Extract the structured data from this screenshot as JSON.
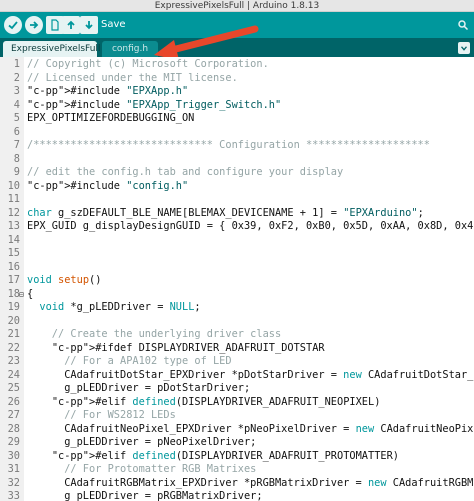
{
  "window": {
    "title": "ExpressivePixelsFull | Arduino 1.8.13"
  },
  "toolbar": {
    "verify_icon": "checkmark-icon",
    "upload_icon": "right-arrow-icon",
    "new_icon": "document-icon",
    "open_icon": "up-arrow-icon",
    "save_icon": "down-arrow-icon",
    "save_label": "Save",
    "serial_icon": "magnifier-icon"
  },
  "tabs": [
    {
      "label": "ExpressivePixelsFull",
      "active": true
    },
    {
      "label": "config.h",
      "active": false
    }
  ],
  "tab_menu_icon": "chevron-down-icon",
  "annotation": {
    "type": "red-arrow",
    "color": "#e8472b"
  },
  "colors": {
    "toolbar": "#00979c",
    "tabbar": "#006468",
    "active_tab": "#e6f3f3",
    "comment": "#95a5a6",
    "keyword": "#00979c",
    "preprocessor": "#5e6d03",
    "function": "#d35400",
    "string": "#005c5f"
  },
  "code_lines": [
    {
      "n": "1",
      "text": "// Copyright (c) Microsoft Corporation."
    },
    {
      "n": "2",
      "text": "// Licensed under the MIT license."
    },
    {
      "n": "3",
      "text": "#include \"EPXApp.h\""
    },
    {
      "n": "4",
      "text": "#include \"EPXApp_Trigger_Switch.h\""
    },
    {
      "n": "5",
      "text": "EPX_OPTIMIZEFORDEBUGGING_ON"
    },
    {
      "n": "6",
      "text": ""
    },
    {
      "n": "7",
      "text": "/***************************** Configuration ********************"
    },
    {
      "n": "8",
      "text": ""
    },
    {
      "n": "9",
      "text": "// edit the config.h tab and configure your display"
    },
    {
      "n": "10",
      "text": "#include \"config.h\""
    },
    {
      "n": "11",
      "text": ""
    },
    {
      "n": "12",
      "text": "char g_szDEFAULT_BLE_NAME[BLEMAX_DEVICENAME + 1] = \"EPXArduino\";"
    },
    {
      "n": "13",
      "text": "EPX_GUID g_displayDesignGUID = { 0x39, 0xF2, 0xB0, 0x5D, 0xAA, 0x8D, 0x49"
    },
    {
      "n": "14",
      "text": ""
    },
    {
      "n": "15",
      "text": ""
    },
    {
      "n": "16",
      "text": ""
    },
    {
      "n": "17",
      "text": "void setup()"
    },
    {
      "n": "18",
      "text": "{"
    },
    {
      "n": "19",
      "text": "  void *g_pLEDDriver = NULL;"
    },
    {
      "n": "20",
      "text": ""
    },
    {
      "n": "21",
      "text": "    // Create the underlying driver class"
    },
    {
      "n": "22",
      "text": "    #ifdef DISPLAYDRIVER_ADAFRUIT_DOTSTAR"
    },
    {
      "n": "23",
      "text": "      // For a APA102 type of LED"
    },
    {
      "n": "24",
      "text": "      CAdafruitDotStar_EPXDriver *pDotStarDriver = new CAdafruitDotStar_E"
    },
    {
      "n": "25",
      "text": "      g_pLEDDriver = pDotStarDriver;"
    },
    {
      "n": "26",
      "text": "    #elif defined(DISPLAYDRIVER_ADAFRUIT_NEOPIXEL)"
    },
    {
      "n": "27",
      "text": "      // For WS2812 LEDs"
    },
    {
      "n": "28",
      "text": "      CAdafruitNeoPixel_EPXDriver *pNeoPixelDriver = new CAdafruitNeoPixe"
    },
    {
      "n": "29",
      "text": "      g_pLEDDriver = pNeoPixelDriver;"
    },
    {
      "n": "30",
      "text": "    #elif defined(DISPLAYDRIVER_ADAFRUIT_PROTOMATTER)"
    },
    {
      "n": "31",
      "text": "      // For Protomatter RGB Matrixes"
    },
    {
      "n": "32",
      "text": "      CAdafruitRGBMatrix_EPXDriver *pRGBMatrixDriver = new CAdafruitRGBMa"
    },
    {
      "n": "33",
      "text": "      g_pLEDDriver = pRGBMatrixDriver;"
    }
  ]
}
